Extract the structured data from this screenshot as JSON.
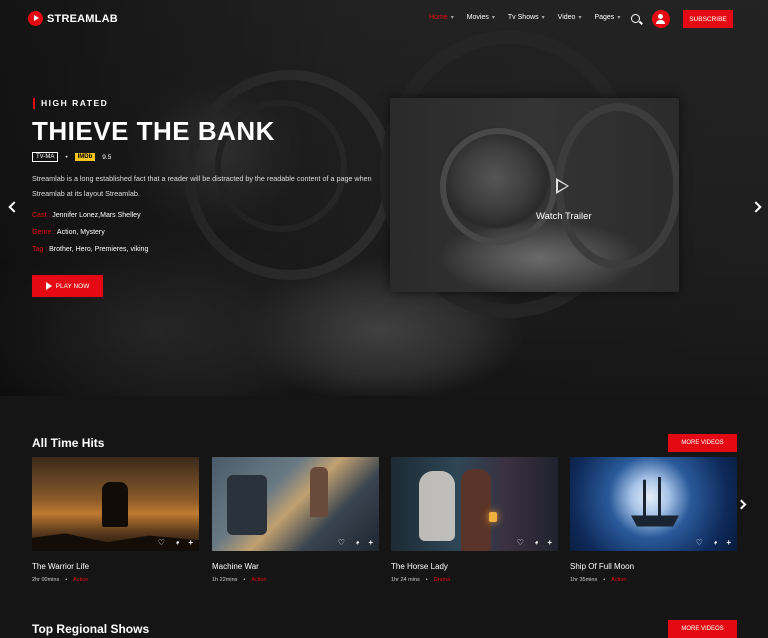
{
  "brand": {
    "name": "STREAMLAB",
    "accent": "#e50914"
  },
  "nav": {
    "items": [
      {
        "label": "Home",
        "active": true
      },
      {
        "label": "Movies",
        "active": false
      },
      {
        "label": "Tv Shows",
        "active": false
      },
      {
        "label": "Video",
        "active": false
      },
      {
        "label": "Pages",
        "active": false
      }
    ],
    "subscribe_label": "SUBSCRIBE"
  },
  "hero": {
    "tagline": "HIGH RATED",
    "title": "THIEVE THE BANK",
    "age_rating": "TV-MA",
    "imdb_label": "IMDb",
    "imdb_score": "9.5",
    "description": "Streamlab is a long established fact that a reader will be distracted by the readable content of a page when Streamlab at its layout Streamlab.",
    "cast_label": "Cast :",
    "cast": "Jennifer Lonez,Mars Shelley",
    "genre_label": "Genre :",
    "genre": "Action, Mystery",
    "tag_label": "Tag :",
    "tags": "Brother, Hero, Premieres, viking",
    "play_label": "PLAY NOW",
    "trailer_label": "Watch Trailer"
  },
  "all_time_hits": {
    "title": "All Time Hits",
    "more_label": "MORE VIDEOS",
    "cards": [
      {
        "title": "The Warrior Life",
        "duration": "2hr 00mins",
        "genre": "Action"
      },
      {
        "title": "Machine War",
        "duration": "1h 22mins",
        "genre": "Action"
      },
      {
        "title": "The Horse Lady",
        "duration": "1hr 24 mins",
        "genre": "Drama"
      },
      {
        "title": "Ship Of Full Moon",
        "duration": "1hr 35mins",
        "genre": "Action"
      }
    ]
  },
  "regional": {
    "title": "Top Regional Shows",
    "more_label": "MORE VIDEOS"
  }
}
